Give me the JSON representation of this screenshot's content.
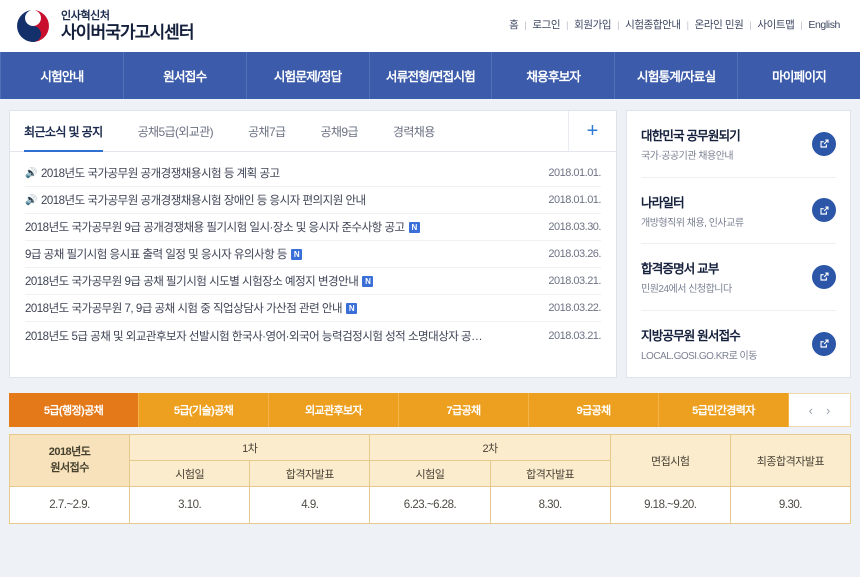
{
  "header": {
    "logo_org": "인사혁신처",
    "logo_site": "사이버국가고시센터",
    "top_links": [
      "홈",
      "로그인",
      "회원가입",
      "시험종합안내",
      "온라인 민원",
      "사이트맵",
      "English"
    ]
  },
  "mainnav": {
    "items": [
      "시험안내",
      "원서접수",
      "시험문제/정답",
      "서류전형/면접시험",
      "채용후보자",
      "시험통계/자료실",
      "마이페이지"
    ]
  },
  "news": {
    "tabs": [
      {
        "label": "최근소식 및 공지",
        "active": true
      },
      {
        "label": "공채5급(외교관)",
        "active": false
      },
      {
        "label": "공채7급",
        "active": false
      },
      {
        "label": "공채9급",
        "active": false
      },
      {
        "label": "경력채용",
        "active": false
      }
    ],
    "more_label": "+",
    "items": [
      {
        "title": "2018년도 국가공무원 공개경쟁채용시험 등 계획 공고",
        "date": "2018.01.01.",
        "speaker": true,
        "new": false
      },
      {
        "title": "2018년도 국가공무원 공개경쟁채용시험 장애인 등 응시자 편의지원 안내",
        "date": "2018.01.01.",
        "speaker": true,
        "new": false
      },
      {
        "title": "2018년도 국가공무원 9급 공개경쟁채용 필기시험 일시·장소 및 응시자 준수사항 공고",
        "date": "2018.03.30.",
        "speaker": false,
        "new": true
      },
      {
        "title": "9급 공채 필기시험 응시표 출력 일정 및 응시자 유의사항 등",
        "date": "2018.03.26.",
        "speaker": false,
        "new": true
      },
      {
        "title": "2018년도 국가공무원 9급 공채 필기시험 시도별 시험장소 예정지 변경안내",
        "date": "2018.03.21.",
        "speaker": false,
        "new": true
      },
      {
        "title": "2018년도 국가공무원 7, 9급 공채 시험 중 직업상담사 가산점 관련 안내",
        "date": "2018.03.22.",
        "speaker": false,
        "new": true
      },
      {
        "title": "2018년도 5급 공채 및 외교관후보자 선발시험 한국사·영어·외국어 능력검정시험 성적 소명대상자 공…",
        "date": "2018.03.21.",
        "speaker": false,
        "new": false
      }
    ]
  },
  "side_cards": [
    {
      "title": "대한민국 공무원되기",
      "sub": "국가·공공기관 채용안내",
      "icon": "external-link-icon"
    },
    {
      "title": "나라일터",
      "sub": "개방형직위 채용, 인사교류",
      "icon": "external-link-icon"
    },
    {
      "title": "합격증명서 교부",
      "sub": "민원24에서 신청합니다",
      "icon": "external-link-icon"
    },
    {
      "title": "지방공무원 원서접수",
      "sub": "LOCAL.GOSI.GO.KR로 이동",
      "icon": "external-link-icon"
    }
  ],
  "schedule": {
    "tabs": [
      {
        "label": "5급(행정)공채",
        "active": true
      },
      {
        "label": "5급(기술)공채",
        "active": false
      },
      {
        "label": "외교관후보자",
        "active": false
      },
      {
        "label": "7급공채",
        "active": false
      },
      {
        "label": "9급공채",
        "active": false
      },
      {
        "label": "5급민간경력자",
        "active": false
      }
    ],
    "prev_label": "‹",
    "next_label": "›",
    "header_first": "2018년도\n원서접수",
    "header_first_line1": "2018년도",
    "header_first_line2": "원서접수",
    "group_1": "1차",
    "group_2": "2차",
    "header_interview": "면접시험",
    "header_final": "최종합격자발표",
    "sub_headers": [
      "시험일",
      "합격자발표",
      "시험일",
      "합격자발표"
    ],
    "row": [
      "2.7.~2.9.",
      "3.10.",
      "4.9.",
      "6.23.~6.28.",
      "8.30.",
      "9.18.~9.20.",
      "9.30."
    ]
  },
  "colors": {
    "nav_blue": "#3c5cab",
    "accent_blue": "#2f6fd0",
    "tab_orange": "#eda01f",
    "tab_orange_active": "#e4791a",
    "table_header": "#fbeccd",
    "page_bg": "#eef1f6"
  }
}
